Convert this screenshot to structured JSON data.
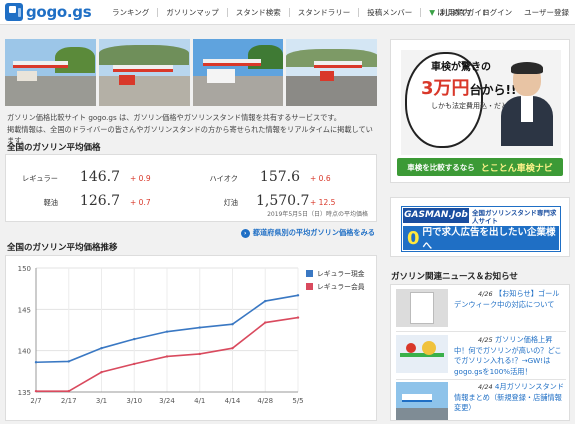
{
  "header": {
    "logo_text": "gogo.gs",
    "nav": [
      "ランキング",
      "ガソリンマップ",
      "スタンド検索",
      "スタンドラリー",
      "投稿メンバー",
      "はじめてガイド"
    ],
    "util": [
      "利用案内",
      "ログイン",
      "ユーザー登録"
    ]
  },
  "intro": {
    "line1": "ガソリン価格比較サイト gogo.gs は、ガソリン価格やガソリンスタンド情報を共有するサービスです。",
    "line2": "掲載情報は、全国のドライバーの皆さんやガソリンスタンドの方から寄せられた情報をリアルタイムに掲載しています。"
  },
  "averages": {
    "title": "全国のガソリン平均価格",
    "items": [
      {
        "label": "レギュラー",
        "value": "146.7",
        "diff": "+ 0.9"
      },
      {
        "label": "ハイオク",
        "value": "157.6",
        "diff": "+ 0.6"
      },
      {
        "label": "軽油",
        "value": "126.7",
        "diff": "+ 0.7"
      },
      {
        "label": "灯油",
        "value": "1,570.7",
        "diff": "+ 12.5"
      }
    ],
    "date": "2019年5月5日（日）時点の平均価格",
    "pref_link": "都道府県別の平均ガソリン価格をみる"
  },
  "chart_section": {
    "title": "全国のガソリン平均価格推移"
  },
  "chart_data": {
    "type": "line",
    "x": [
      "2/7",
      "2/17",
      "3/1",
      "3/10",
      "3/24",
      "4/1",
      "4/14",
      "4/28",
      "5/5"
    ],
    "series": [
      {
        "name": "レギュラー現金",
        "color": "#3a78c3",
        "values": [
          138.6,
          138.7,
          140.3,
          141.4,
          142.3,
          142.8,
          143.2,
          146.0,
          146.7
        ]
      },
      {
        "name": "レギュラー会員",
        "color": "#d94a5e",
        "values": [
          135.1,
          135.1,
          137.4,
          138.4,
          139.3,
          139.6,
          140.3,
          143.4,
          144.0
        ]
      }
    ],
    "xlabel": "",
    "ylabel": "",
    "yticks": [
      "135",
      "140",
      "145",
      "150"
    ],
    "ylim": [
      135,
      150
    ],
    "grid": true,
    "legend": "top-right"
  },
  "ads": {
    "ad1": {
      "line1": "車検が驚きの",
      "line2_big": "3万円",
      "line2_rest": "台から!!",
      "line3": "しかも法定費用込・だと!?",
      "bar_left": "車検を比較するなら",
      "bar_right": "とことん車検ナビ"
    },
    "ad2": {
      "logo": "GASMAN.Job",
      "sub": "全国ガソリンスタンド専門求人サイト",
      "zero": "0",
      "main": "円で求人広告を出したい企業様へ"
    }
  },
  "news": {
    "title": "ガソリン関連ニュース＆お知らせ",
    "items": [
      {
        "date": "4/26",
        "text": "【お知らせ】ゴールデンウィーク中の対応について"
      },
      {
        "date": "4/25",
        "text": "ガソリン価格上昇中！何でガソリンが高いの？どこでガソリン入れる!？→GW!はgogo.gsを100%活用！"
      },
      {
        "date": "4/24",
        "text": "4月ガソリンスタンド情報まとめ（新規登録・店舗情報変更）"
      }
    ]
  },
  "colors": {
    "brand": "#1f6fc5",
    "up": "#d9382a"
  }
}
